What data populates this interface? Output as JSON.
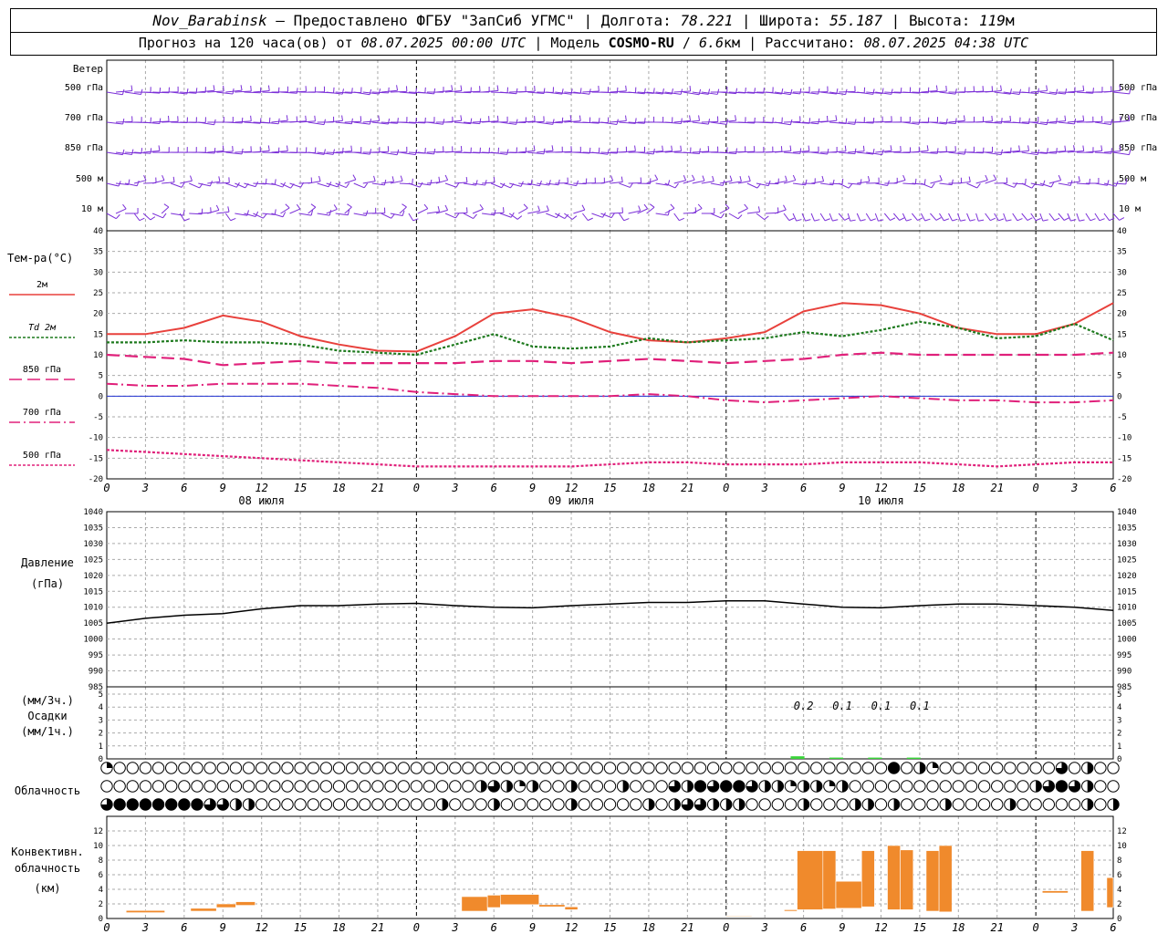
{
  "header": {
    "station": "Nov_Barabinsk",
    "dash": "—",
    "provider": "Предоставлено ФГБУ \"ЗапСиб УГМС\"",
    "sep": "|",
    "lon_label": "Долгота:",
    "lon": "78.221",
    "lat_label": "Широта:",
    "lat": "55.187",
    "alt_label": "Высота:",
    "alt": "119",
    "alt_unit": "м",
    "forecast_prefix": "Прогноз на 120 часа(ов) от",
    "forecast_date": "08.07.2025 00:00 UTC",
    "model_label": "Модель",
    "model": "COSMO-RU",
    "slash": "/",
    "resolution": "6.6",
    "resolution_unit": "км",
    "computed_label": "Рассчитано:",
    "computed": "08.07.2025 04:38 UTC"
  },
  "colors": {
    "t2m": "#e8413c",
    "td": "#1e7a1e",
    "t850": "#e0207a",
    "t700": "#e0207a",
    "t500": "#e0207a",
    "wind": "#7b2fd8",
    "precip": "#3ad43a",
    "convective": "#f08a2c",
    "zero_line": "#2030d0"
  },
  "wind_panel": {
    "title": "Ветер",
    "levels": [
      "500 гПа",
      "700 гПа",
      "850 гПа",
      "500 м",
      "10 м"
    ]
  },
  "temp_panel": {
    "title": "Тем-ра(°С)",
    "legend": [
      {
        "label": "2м",
        "key": "t2m"
      },
      {
        "label": "Td 2м",
        "key": "td"
      },
      {
        "label": "850 гПа",
        "key": "t850"
      },
      {
        "label": "700 гПа",
        "key": "t700"
      },
      {
        "label": "500 гПа",
        "key": "t500"
      }
    ],
    "yticks": [
      "40",
      "35",
      "30",
      "25",
      "20",
      "15",
      "10",
      "5",
      "0",
      "-5",
      "-10",
      "-15",
      "-20"
    ]
  },
  "time_axis": {
    "hour_labels": [
      "0",
      "3",
      "6",
      "9",
      "12",
      "15",
      "18",
      "21",
      "0",
      "3",
      "6",
      "9",
      "12",
      "15",
      "18",
      "21",
      "0",
      "3",
      "6",
      "9",
      "12",
      "15",
      "18",
      "21",
      "0",
      "3",
      "6"
    ],
    "dates": [
      "08 июля",
      "09 июля",
      "10 июля"
    ]
  },
  "pressure_panel": {
    "title": "Давление",
    "unit": "(гПа)",
    "yticks": [
      "1040",
      "1035",
      "1030",
      "1025",
      "1020",
      "1015",
      "1010",
      "1005",
      "1000",
      "995",
      "990",
      "985"
    ]
  },
  "precip_panel": {
    "unit3": "(мм/3ч.)",
    "title": "Осадки",
    "unit1": "(мм/1ч.)",
    "yticks": [
      "5",
      "4",
      "3",
      "2",
      "1",
      "0"
    ],
    "annotations": [
      "0.2",
      "0.1",
      "0.1",
      "0.1"
    ]
  },
  "cloud_panel": {
    "title": "Облачность"
  },
  "conv_panel": {
    "title1": "Конвективн.",
    "title2": "облачность",
    "unit": "(км)",
    "yticks": [
      "12",
      "10",
      "8",
      "6",
      "4",
      "2",
      "0"
    ]
  },
  "chart_data": [
    {
      "type": "line",
      "title": "Тем-ра(°С)",
      "x_unit": "hours since 08.07.2025 00:00 UTC",
      "ylim": [
        -20,
        40
      ],
      "grid": true,
      "x": [
        0,
        3,
        6,
        9,
        12,
        15,
        18,
        21,
        24,
        27,
        30,
        33,
        36,
        39,
        42,
        45,
        48,
        51,
        54,
        57,
        60,
        63,
        66,
        69,
        72,
        75,
        78
      ],
      "series": [
        {
          "name": "2м",
          "values": [
            15,
            15,
            16.5,
            19.5,
            18,
            14.5,
            12.5,
            11,
            10.8,
            14.5,
            20,
            21,
            19,
            15.5,
            13.5,
            13,
            14,
            15.5,
            20.5,
            22.5,
            22,
            20,
            16.5,
            15,
            15,
            17.5,
            22.5
          ]
        },
        {
          "name": "Td 2м",
          "values": [
            13,
            13,
            13.5,
            13,
            13,
            12.5,
            11,
            10.5,
            10,
            12.5,
            15,
            12,
            11.5,
            12,
            14,
            13,
            13.5,
            14,
            15.5,
            14.5,
            16,
            18,
            16.5,
            14,
            14.5,
            17.5,
            13.5
          ]
        },
        {
          "name": "850 гПа",
          "values": [
            10,
            9.5,
            9,
            7.5,
            8,
            8.5,
            8,
            8,
            8,
            8,
            8.5,
            8.5,
            8,
            8.5,
            9,
            8.5,
            8,
            8.5,
            9,
            10,
            10.5,
            10,
            10,
            10,
            10,
            10,
            10.5
          ]
        },
        {
          "name": "700 гПа",
          "values": [
            3,
            2.5,
            2.5,
            3,
            3,
            3,
            2.5,
            2,
            1,
            0.5,
            0,
            0,
            0,
            0,
            0.5,
            0,
            -1,
            -1.5,
            -1,
            -0.5,
            0,
            -0.5,
            -1,
            -1,
            -1.5,
            -1.5,
            -1
          ]
        },
        {
          "name": "500 гПа",
          "values": [
            -13,
            -13.5,
            -14,
            -14.5,
            -15,
            -15.5,
            -16,
            -16.5,
            -17,
            -17,
            -17,
            -17,
            -17,
            -16.5,
            -16,
            -16,
            -16.5,
            -16.5,
            -16.5,
            -16,
            -16,
            -16,
            -16.5,
            -17,
            -16.5,
            -16,
            -16
          ]
        }
      ]
    },
    {
      "type": "line",
      "title": "Давление",
      "ylabel": "(гПа)",
      "ylim": [
        985,
        1040
      ],
      "grid": true,
      "x": [
        0,
        3,
        6,
        9,
        12,
        15,
        18,
        21,
        24,
        27,
        30,
        33,
        36,
        39,
        42,
        45,
        48,
        51,
        54,
        57,
        60,
        63,
        66,
        69,
        72,
        75,
        78
      ],
      "series": [
        {
          "values": [
            1005,
            1006.5,
            1007.5,
            1008,
            1009.5,
            1010.5,
            1010.5,
            1011,
            1011.2,
            1010.5,
            1010,
            1009.8,
            1010.5,
            1011,
            1011.5,
            1011.5,
            1012,
            1012,
            1011,
            1010,
            1009.8,
            1010.5,
            1011,
            1011,
            1010.5,
            1010,
            1009
          ]
        }
      ]
    },
    {
      "type": "bar",
      "title": "Осадки",
      "ylabel": "(мм/3ч.)",
      "ylim": [
        0,
        5
      ],
      "x": [
        54,
        57,
        60,
        63
      ],
      "values": [
        0.2,
        0.1,
        0.1,
        0.1
      ]
    },
    {
      "type": "table",
      "title": "Облачность",
      "note": "cloud cover fraction per 1h step, three layers (upper, middle, lower)",
      "rows": {
        "upper": {
          "x": [
            0,
            61,
            63,
            64,
            74,
            76
          ],
          "values": [
            0.25,
            1,
            0.5,
            0.25,
            0.75,
            0.5
          ]
        },
        "middle": {
          "x": [
            29,
            30,
            31,
            32,
            33,
            36,
            40,
            44,
            45,
            46,
            47,
            48,
            49,
            50,
            51,
            52,
            53,
            54,
            55,
            56,
            57,
            72,
            73,
            74,
            75,
            76
          ],
          "values": [
            0.5,
            0.75,
            0.5,
            0.25,
            0.5,
            0.5,
            0.5,
            0.75,
            0.5,
            1,
            0.75,
            1,
            1,
            0.75,
            0.5,
            0.5,
            0.25,
            0.5,
            0.5,
            0.25,
            0.5,
            0.5,
            0.75,
            1,
            0.75,
            0.5
          ]
        },
        "lower": {
          "x": [
            0,
            1,
            2,
            3,
            4,
            5,
            6,
            7,
            8,
            9,
            10,
            11,
            26,
            30,
            36,
            42,
            44,
            45,
            46,
            47,
            48,
            49,
            54,
            58,
            59,
            61,
            65,
            70,
            76,
            78
          ],
          "values": [
            0.75,
            1,
            1,
            1,
            1,
            1,
            1,
            1,
            0.75,
            0.75,
            0.5,
            0.5,
            0.5,
            0.5,
            0.5,
            0.5,
            0.5,
            0.75,
            0.75,
            0.5,
            0.5,
            0.5,
            0.5,
            0.5,
            0.5,
            0.5,
            0.5,
            0.5,
            0.5,
            0.5
          ]
        }
      }
    },
    {
      "type": "bar",
      "title": "Конвективн. облачность",
      "ylabel": "(км)",
      "ylim": [
        0,
        13
      ],
      "note": "each bar: [start_hour, end_hour, base_km, top_km]",
      "bars": [
        [
          1.5,
          4.5,
          0.8,
          1.1
        ],
        [
          6.5,
          8.5,
          1.0,
          1.4
        ],
        [
          8.5,
          10,
          1.5,
          2.0
        ],
        [
          10,
          11.5,
          1.8,
          2.3
        ],
        [
          27.5,
          29.5,
          1.0,
          3.0
        ],
        [
          29.5,
          30.5,
          1.5,
          3.2
        ],
        [
          30.5,
          33.5,
          1.9,
          3.3
        ],
        [
          33.5,
          35.5,
          1.6,
          1.9
        ],
        [
          35.5,
          36.5,
          1.2,
          1.6
        ],
        [
          48,
          50,
          0.3,
          0.4
        ],
        [
          52.5,
          53.5,
          1.0,
          1.2
        ],
        [
          53.5,
          55.5,
          1.2,
          9.3
        ],
        [
          55.5,
          56.5,
          1.3,
          9.3
        ],
        [
          56.5,
          58.5,
          1.4,
          5.1
        ],
        [
          58.5,
          59.5,
          1.6,
          9.3
        ],
        [
          60.5,
          61.5,
          1.2,
          10.0
        ],
        [
          61.5,
          62.5,
          1.2,
          9.4
        ],
        [
          63.5,
          64.5,
          1.0,
          9.3
        ],
        [
          64.5,
          65.5,
          0.9,
          10.0
        ],
        [
          72.5,
          74.5,
          3.5,
          3.8
        ],
        [
          75.5,
          76.5,
          1.0,
          9.3
        ],
        [
          77.5,
          78,
          1.5,
          5.6
        ]
      ]
    }
  ]
}
